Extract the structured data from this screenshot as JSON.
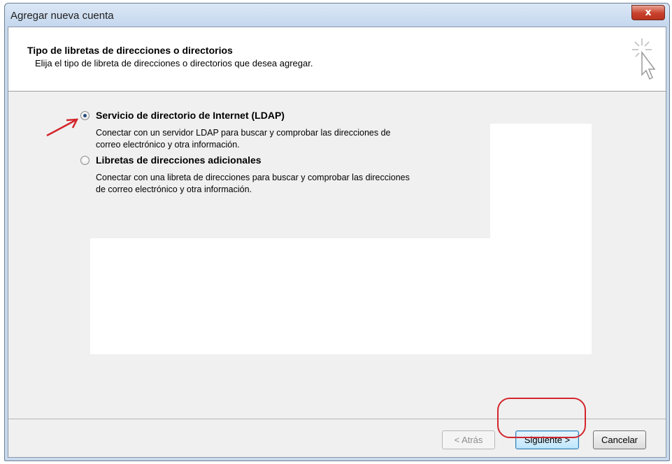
{
  "window": {
    "title": "Agregar nueva cuenta",
    "close_symbol": "x"
  },
  "header": {
    "title": "Tipo de libretas de direcciones o directorios",
    "subtitle": "Elija el tipo de libreta de direcciones o directorios que desea agregar.",
    "icon": "wizard-cursor-icon"
  },
  "options": [
    {
      "label": "Servicio de directorio de Internet (LDAP)",
      "desc_line1": "Conectar con un servidor LDAP para buscar y comprobar las direcciones de",
      "desc_line2": "correo electrónico y otra información.",
      "selected": true
    },
    {
      "label": "Libretas de direcciones adicionales",
      "desc_line1": "Conectar con una libreta de direcciones para buscar y comprobar las direcciones",
      "desc_line2": "de correo electrónico y otra información.",
      "selected": false
    }
  ],
  "buttons": {
    "back": "< Atrás",
    "next": "Siguiente >",
    "cancel": "Cancelar"
  },
  "colors": {
    "annotation": "#d3262c",
    "close_button": "#c8412c",
    "titlebar": "#c5d7ee"
  }
}
